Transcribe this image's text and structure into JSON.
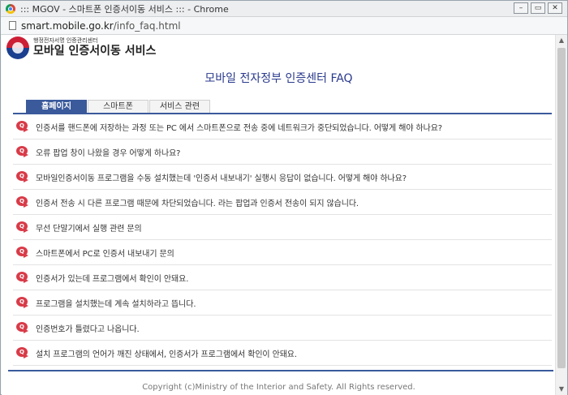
{
  "window": {
    "title": "::: MGOV - 스마트폰 인증서이동 서비스 ::: - Chrome",
    "controls": {
      "minimize": "–",
      "restore": "▭",
      "close": "✕"
    }
  },
  "address": {
    "host": "smart.mobile.go.kr",
    "path": "/info_faq.html"
  },
  "logo": {
    "small_text": "행정전자서명 인증관리센터",
    "big_text": "모바일 인증서이동 서비스"
  },
  "page_title": "모바일 전자정부 인증센터 FAQ",
  "tabs": [
    {
      "label": "홈페이지"
    },
    {
      "label": "스마트폰"
    },
    {
      "label": "서비스 관련"
    }
  ],
  "faq_icon_letter": "Q",
  "faq": [
    {
      "text": "인증서를 핸드폰에 저장하는 과정 또는 PC 에서 스마트폰으로 전송 중에 네트워크가 중단되었습니다. 어떻게 해야 하나요?"
    },
    {
      "text": "오류 팝업 창이 나왔을 경우 어떻게 하나요?"
    },
    {
      "text": "모바일인증서이동 프로그램을 수동 설치했는데 '인증서 내보내기' 실행시 응답이 없습니다. 어떻게 해야 하나요?"
    },
    {
      "text": "인증서 전송 시 다른 프로그램 때문에 차단되었습니다. 라는 팝업과 인증서 전송이 되지 않습니다."
    },
    {
      "text": "무선 단말기에서 실행 관련 문의"
    },
    {
      "text": "스마트폰에서 PC로 인증서 내보내기 문의"
    },
    {
      "text": "인증서가 있는데 프로그램에서 확인이 안돼요."
    },
    {
      "text": "프로그램을 설치했는데 계속 설치하라고 뜹니다."
    },
    {
      "text": "인증번호가 틀렸다고 나옵니다."
    },
    {
      "text": "설치 프로그램의 언어가 깨진 상태에서, 인증서가 프로그램에서 확인이 안돼요."
    }
  ],
  "footer": "Copyright (c)Ministry of the Interior and Safety. All Rights reserved."
}
